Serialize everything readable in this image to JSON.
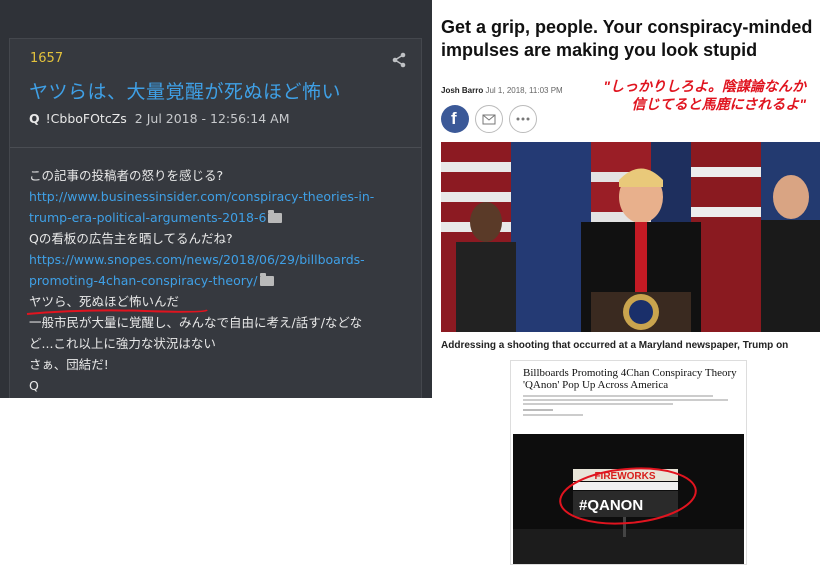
{
  "post": {
    "number": "1657",
    "title": "ヤツらは、大量覚醒が死ぬほど怖い",
    "author": "Q",
    "tripcode": "!CbboFOtcZs",
    "date": "2 Jul 2018 - 12:56:14 AM",
    "lines": {
      "l1": "この記事の投稿者の怒りを感じる?",
      "link1a": "http://www.businessinsider.com/conspiracy-theories-in-",
      "link1b": "trump-era-political-arguments-2018-6",
      "l4": "Qの看板の広告主を晒してるんだね?",
      "link2a": "https://www.snopes.com/news/2018/06/29/billboards-",
      "link2b": "promoting-4chan-conspiracy-theory/",
      "l7": "ヤツら、死ぬほど怖いんだ",
      "l8": "一般市民が大量に覚醒し、みんなで自由に考え/話す/などな",
      "l9": "ど...これ以上に強力な状況はない",
      "l10": "さぁ、団結だ!",
      "l11": "Q"
    }
  },
  "article": {
    "headline": "Get a grip, people. Your conspiracy-minded impulses are making you look stupid",
    "author": "Josh Barro",
    "date": "Jul 1, 2018, 11:03 PM",
    "red_caption_line1": "\"しっかりしろよ。陰謀論なんか",
    "red_caption_line2": "信じてると馬鹿にされるよ\"",
    "facebook": "f",
    "photo_caption": "Addressing a shooting that occurred at a Maryland newspaper, Trump on"
  },
  "news2": {
    "title": "Billboards Promoting 4Chan Conspiracy Theory 'QAnon' Pop Up Across America",
    "billboard_top": "FIREWORKS",
    "billboard_main": "#QANON"
  },
  "colors": {
    "panel_bg": "#2f3238",
    "link": "#3fa0e6",
    "post_number": "#e2c13c",
    "red_annotation": "#e0141f",
    "facebook": "#3b5998"
  },
  "icons": [
    "share-icon",
    "folder-icon",
    "facebook-icon",
    "mail-icon",
    "more-icon"
  ]
}
